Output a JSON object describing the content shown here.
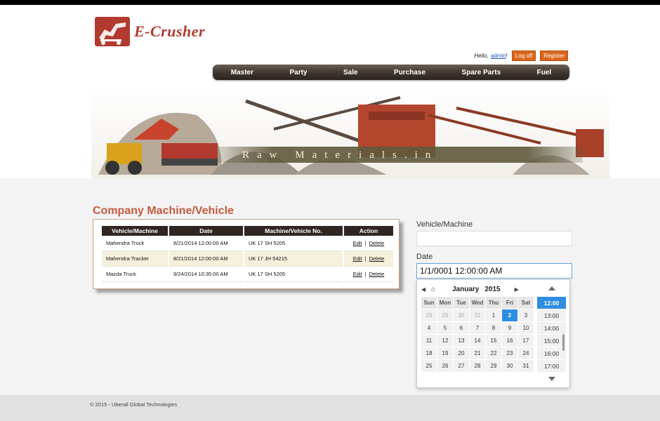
{
  "brand": {
    "name": "E-Crusher"
  },
  "login": {
    "greeting": "Hello,",
    "user": "admin",
    "suffix": "!",
    "logoff_label": "Log off",
    "register_label": "Register"
  },
  "nav": {
    "items": [
      {
        "label": "Master"
      },
      {
        "label": "Party"
      },
      {
        "label": "Sale"
      },
      {
        "label": "Purchase"
      },
      {
        "label": "Spare Parts"
      },
      {
        "label": "Fuel"
      }
    ]
  },
  "banner": {
    "text": "Raw Materials.in"
  },
  "page": {
    "title": "Company Machine/Vehicle"
  },
  "table": {
    "headers": [
      "Vehicle/Machine",
      "Date",
      "Machine/Vehicle No.",
      "Action"
    ],
    "rows": [
      {
        "vehicle": "Mahendra Truck",
        "date": "8/21/2014 12:00:00 AM",
        "number": "UK 17 SH 5205",
        "edit": "Edit",
        "sep": "|",
        "delete": "Delete"
      },
      {
        "vehicle": "Mahendra Tracker",
        "date": "8/21/2014 12:00:00 AM",
        "number": "UK 17 JH 54215",
        "edit": "Edit",
        "sep": "|",
        "delete": "Delete"
      },
      {
        "vehicle": "Mazda Truck",
        "date": "9/24/2014 10:35:00 AM",
        "number": "UK 17 SH 5205",
        "edit": "Edit",
        "sep": "|",
        "delete": "Delete"
      }
    ]
  },
  "form": {
    "vehicle_label": "Vehicle/Machine",
    "vehicle_value": "",
    "date_label": "Date",
    "date_value": "1/1/0001 12:00:00 AM"
  },
  "picker": {
    "month": "January",
    "year": "2015",
    "days_of_week": [
      "Sun",
      "Mon",
      "Tue",
      "Wed",
      "Thu",
      "Fri",
      "Sat"
    ],
    "weeks": [
      [
        "28",
        "29",
        "30",
        "31",
        "1",
        "2",
        "3"
      ],
      [
        "4",
        "5",
        "6",
        "7",
        "8",
        "9",
        "10"
      ],
      [
        "11",
        "12",
        "13",
        "14",
        "15",
        "16",
        "17"
      ],
      [
        "18",
        "19",
        "20",
        "21",
        "22",
        "23",
        "24"
      ],
      [
        "25",
        "26",
        "27",
        "28",
        "29",
        "30",
        "31"
      ]
    ],
    "selected_day": "2",
    "times": [
      "12:00",
      "13:00",
      "14:00",
      "15:00",
      "16:00",
      "17:00"
    ],
    "selected_time": "12:00"
  },
  "footer": {
    "text": "© 2015 - Uberall Global Technologies"
  },
  "colors": {
    "accent": "#d9661d",
    "title": "#c55a3e",
    "nav_dark": "#2f2622",
    "selected": "#2e8de0"
  }
}
